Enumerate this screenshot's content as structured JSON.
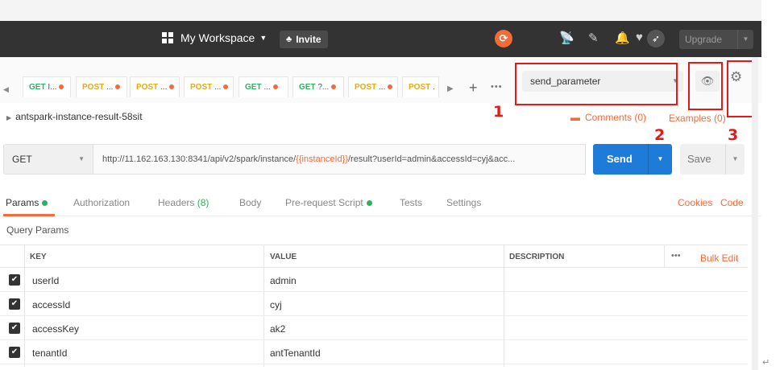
{
  "header": {
    "workspace_label": "My Workspace",
    "invite_label": "Invite",
    "upgrade_label": "Upgrade"
  },
  "tabs": [
    {
      "method": "GET",
      "name": "I..."
    },
    {
      "method": "POST",
      "name": "..."
    },
    {
      "method": "POST",
      "name": "..."
    },
    {
      "method": "POST",
      "name": "..."
    },
    {
      "method": "GET",
      "name": "..."
    },
    {
      "method": "GET",
      "name": "?..."
    },
    {
      "method": "POST",
      "name": "..."
    },
    {
      "method": "POST",
      "name": "."
    }
  ],
  "environment": {
    "selected": "send_parameter"
  },
  "annotations": [
    "1",
    "2",
    "3"
  ],
  "request": {
    "name": "antspark-instance-result-58sit",
    "comments_label": "Comments (0)",
    "examples_label": "Examples (0)",
    "method": "GET",
    "url_prefix": "http://11.162.163.130:8341/api/v2/spark/instance/",
    "url_var": "{{instanceId}}",
    "url_suffix": "/result?userId=admin&accessId=cyj&acc...",
    "send_label": "Send",
    "save_label": "Save"
  },
  "subtabs": {
    "params": "Params",
    "authorization": "Authorization",
    "headers": "Headers",
    "headers_count": "(8)",
    "body": "Body",
    "prerequest": "Pre-request Script",
    "tests": "Tests",
    "settings": "Settings",
    "cookies": "Cookies",
    "code": "Code"
  },
  "params": {
    "section_title": "Query Params",
    "col_key": "KEY",
    "col_value": "VALUE",
    "col_description": "DESCRIPTION",
    "bulk_edit": "Bulk Edit",
    "rows": [
      {
        "key": "userId",
        "value": "admin",
        "checked": true
      },
      {
        "key": "accessId",
        "value": "cyj",
        "checked": true
      },
      {
        "key": "accessKey",
        "value": "ak2",
        "checked": true
      },
      {
        "key": "tenantId",
        "value": "antTenantId",
        "checked": true
      }
    ]
  },
  "colors": {
    "accent_orange": "#f26b3a",
    "send_blue": "#1f7bd8",
    "get_green": "#2bb160",
    "post_yellow": "#e8aa0e",
    "annotation_red": "#e21a1a"
  }
}
